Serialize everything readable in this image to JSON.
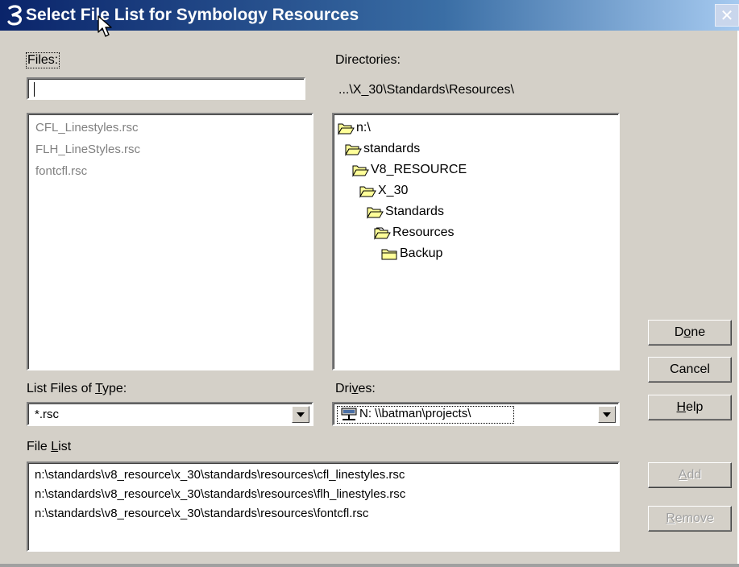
{
  "window": {
    "title": "Select File List for Symbology Resources",
    "close_glyph": "✕"
  },
  "files": {
    "label": "Files:",
    "input_value": "",
    "items": [
      "CFL_Linestyles.rsc",
      "FLH_LineStyles.rsc",
      "fontcfl.rsc"
    ]
  },
  "directories": {
    "label": "Directories:",
    "current_path": "...\\X_30\\Standards\\Resources\\",
    "tree": [
      {
        "label": "n:\\",
        "icon": "open-folder-icon"
      },
      {
        "label": "standards",
        "icon": "open-folder-icon"
      },
      {
        "label": "V8_RESOURCE",
        "icon": "open-folder-icon"
      },
      {
        "label": "X_30",
        "icon": "open-folder-icon"
      },
      {
        "label": "Standards",
        "icon": "open-folder-icon"
      },
      {
        "label": "Resources",
        "icon": "open-folder-icon"
      },
      {
        "label": "Backup",
        "icon": "closed-folder-icon"
      }
    ]
  },
  "type_filter": {
    "label_pre": "List Files of ",
    "label_accel": "T",
    "label_post": "ype:",
    "value": "*.rsc"
  },
  "drives": {
    "label_pre": "Dri",
    "label_accel": "v",
    "label_post": "es:",
    "value": "N: \\\\batman\\projects\\",
    "icon": "network-drive-icon"
  },
  "file_list": {
    "label_pre": "File ",
    "label_accel": "L",
    "label_post": "ist",
    "entries": [
      "n:\\standards\\v8_resource\\x_30\\standards\\resources\\cfl_linestyles.rsc",
      "n:\\standards\\v8_resource\\x_30\\standards\\resources\\flh_linestyles.rsc",
      "n:\\standards\\v8_resource\\x_30\\standards\\resources\\fontcfl.rsc"
    ]
  },
  "buttons": {
    "done": {
      "pre": "D",
      "accel": "o",
      "post": "ne"
    },
    "cancel": {
      "label": "Cancel"
    },
    "help": {
      "pre": "",
      "accel": "H",
      "post": "elp"
    },
    "add": {
      "pre": "",
      "accel": "A",
      "post": "dd",
      "enabled": false
    },
    "remove": {
      "pre": "",
      "accel": "R",
      "post": "emove",
      "enabled": false
    }
  },
  "colors": {
    "title_gradient_start": "#0a246a",
    "title_gradient_end": "#a6caf0",
    "dialog_face": "#d4d0c8",
    "folder_yellow": "#ffff99"
  }
}
